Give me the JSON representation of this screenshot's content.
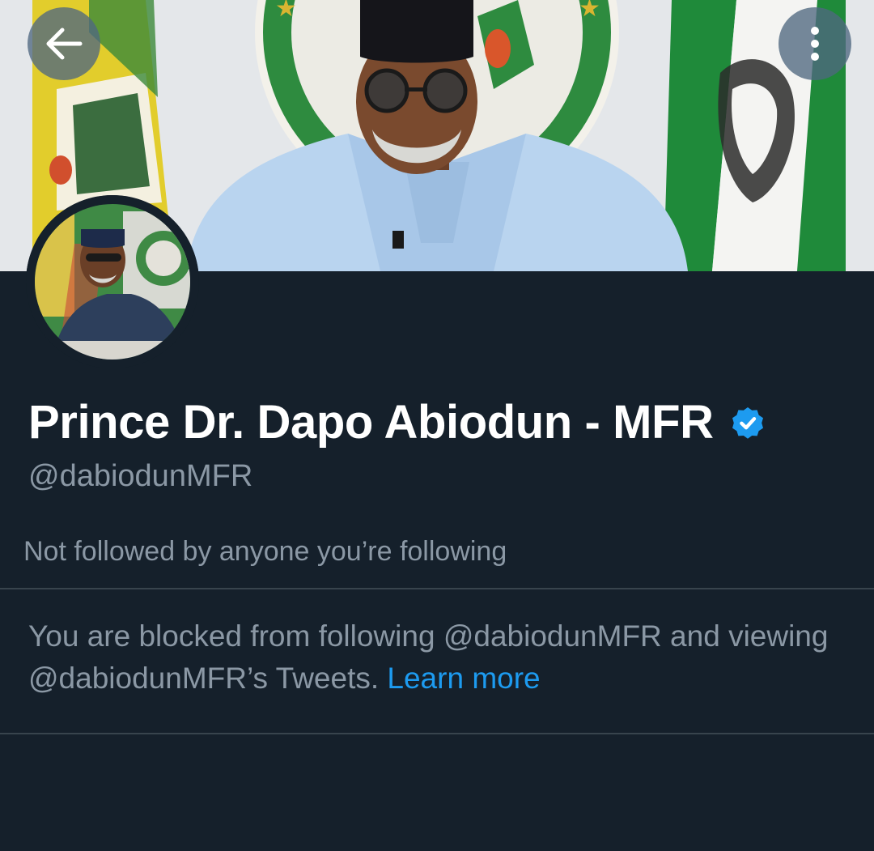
{
  "header": {
    "back_icon": "arrow-left-icon",
    "more_icon": "more-vertical-icon"
  },
  "profile": {
    "display_name": "Prince Dr. Dapo Abiodun - MFR",
    "verified_icon": "verified-badge-icon",
    "handle": "@dabiodunMFR",
    "followers_note": "Not followed by anyone you’re following"
  },
  "blocked": {
    "message_part1": "You are blocked from following @dabiodunMFR and viewing @dabiodunMFR’s Tweets.",
    "learn_more_label": "Learn more"
  },
  "colors": {
    "background": "#15202b",
    "primary_text": "#ffffff",
    "secondary_text": "#8b98a5",
    "link": "#1d9bf0",
    "divider": "#38444d"
  }
}
